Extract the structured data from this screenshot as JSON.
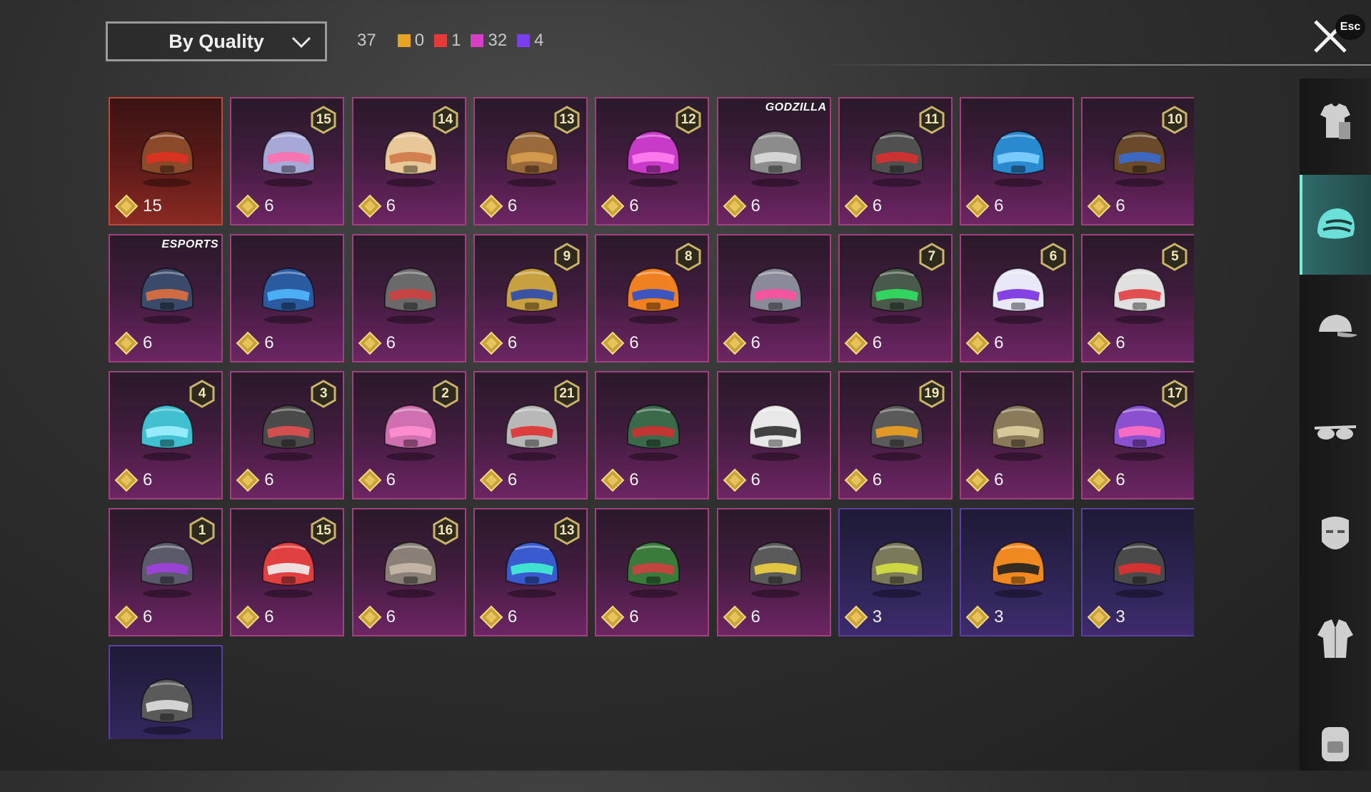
{
  "sort": {
    "label": "By Quality"
  },
  "counts": {
    "total": "37",
    "qualities": [
      {
        "color": "#e8a322",
        "value": "0"
      },
      {
        "color": "#e53a35",
        "value": "1"
      },
      {
        "color": "#d63fc4",
        "value": "32"
      },
      {
        "color": "#7a3df0",
        "value": "4"
      }
    ]
  },
  "close": {
    "esc_label": "Esc"
  },
  "items": [
    {
      "quality": "legendary",
      "price": "15",
      "badge": "",
      "tag": "",
      "color": "#8a4a2a",
      "accent": "#e03020"
    },
    {
      "quality": "mythic",
      "price": "6",
      "badge": "15",
      "tag": "",
      "color": "#a8a8d8",
      "accent": "#ff6fae"
    },
    {
      "quality": "mythic",
      "price": "6",
      "badge": "14",
      "tag": "",
      "color": "#e8c898",
      "accent": "#d07848"
    },
    {
      "quality": "mythic",
      "price": "6",
      "badge": "13",
      "tag": "",
      "color": "#9a6a3a",
      "accent": "#d9a050"
    },
    {
      "quality": "mythic",
      "price": "6",
      "badge": "12",
      "tag": "",
      "color": "#c83ac8",
      "accent": "#ff7ff0"
    },
    {
      "quality": "mythic",
      "price": "6",
      "badge": "",
      "tag": "GODZILLA",
      "color": "#8c8c8c",
      "accent": "#dcdcdc"
    },
    {
      "quality": "mythic",
      "price": "6",
      "badge": "11",
      "tag": "",
      "color": "#505050",
      "accent": "#d83030"
    },
    {
      "quality": "mythic",
      "price": "6",
      "badge": "",
      "tag": "",
      "color": "#2a8ad0",
      "accent": "#7fd0ff"
    },
    {
      "quality": "mythic",
      "price": "6",
      "badge": "10",
      "tag": "",
      "color": "#6a4a2a",
      "accent": "#3a6ad0"
    },
    {
      "quality": "mythic",
      "price": "6",
      "badge": "",
      "tag": "ESPORTS",
      "color": "#3a4a6a",
      "accent": "#e07040"
    },
    {
      "quality": "mythic",
      "price": "6",
      "badge": "",
      "tag": "",
      "color": "#2a5aa0",
      "accent": "#50b8ff"
    },
    {
      "quality": "mythic",
      "price": "6",
      "badge": "",
      "tag": "",
      "color": "#6a6a6a",
      "accent": "#d04040"
    },
    {
      "quality": "mythic",
      "price": "6",
      "badge": "9",
      "tag": "",
      "color": "#c8a040",
      "accent": "#2a4ab0"
    },
    {
      "quality": "mythic",
      "price": "6",
      "badge": "8",
      "tag": "",
      "color": "#f08020",
      "accent": "#2a50d0"
    },
    {
      "quality": "mythic",
      "price": "6",
      "badge": "",
      "tag": "",
      "color": "#8a8a9a",
      "accent": "#ff4fa0"
    },
    {
      "quality": "mythic",
      "price": "6",
      "badge": "7",
      "tag": "",
      "color": "#4a5a4a",
      "accent": "#30e060"
    },
    {
      "quality": "mythic",
      "price": "6",
      "badge": "6",
      "tag": "",
      "color": "#e8e8f8",
      "accent": "#7a30e0"
    },
    {
      "quality": "mythic",
      "price": "6",
      "badge": "5",
      "tag": "",
      "color": "#e0e0e0",
      "accent": "#e04040"
    },
    {
      "quality": "mythic",
      "price": "6",
      "badge": "4",
      "tag": "",
      "color": "#40c0d0",
      "accent": "#a0f0ff"
    },
    {
      "quality": "mythic",
      "price": "6",
      "badge": "3",
      "tag": "",
      "color": "#4a4a4a",
      "accent": "#e05050"
    },
    {
      "quality": "mythic",
      "price": "6",
      "badge": "2",
      "tag": "",
      "color": "#d070b0",
      "accent": "#ff90d0"
    },
    {
      "quality": "mythic",
      "price": "6",
      "badge": "21",
      "tag": "",
      "color": "#b8b8b8",
      "accent": "#e03030"
    },
    {
      "quality": "mythic",
      "price": "6",
      "badge": "",
      "tag": "",
      "color": "#3a6a4a",
      "accent": "#d03030"
    },
    {
      "quality": "mythic",
      "price": "6",
      "badge": "",
      "tag": "",
      "color": "#e8e8e8",
      "accent": "#303030"
    },
    {
      "quality": "mythic",
      "price": "6",
      "badge": "19",
      "tag": "",
      "color": "#5a5a5a",
      "accent": "#f0a020"
    },
    {
      "quality": "mythic",
      "price": "6",
      "badge": "",
      "tag": "",
      "color": "#8a7a5a",
      "accent": "#e0d0a0"
    },
    {
      "quality": "mythic",
      "price": "6",
      "badge": "17",
      "tag": "",
      "color": "#8a50d0",
      "accent": "#ff70c0"
    },
    {
      "quality": "mythic",
      "price": "6",
      "badge": "1",
      "tag": "",
      "color": "#5a5a6a",
      "accent": "#a040e0"
    },
    {
      "quality": "mythic",
      "price": "6",
      "badge": "15",
      "tag": "",
      "color": "#e04040",
      "accent": "#f0f0f0"
    },
    {
      "quality": "mythic",
      "price": "6",
      "badge": "16",
      "tag": "",
      "color": "#8a8078",
      "accent": "#c8b8a8"
    },
    {
      "quality": "mythic",
      "price": "6",
      "badge": "13",
      "tag": "",
      "color": "#3a5ad0",
      "accent": "#40f0d0"
    },
    {
      "quality": "mythic",
      "price": "6",
      "badge": "",
      "tag": "",
      "color": "#3a7a3a",
      "accent": "#d04040"
    },
    {
      "quality": "mythic",
      "price": "6",
      "badge": "",
      "tag": "",
      "color": "#5a5a5a",
      "accent": "#f0d040"
    },
    {
      "quality": "epic",
      "price": "3",
      "badge": "",
      "tag": "",
      "color": "#7a7a5a",
      "accent": "#d8e040"
    },
    {
      "quality": "epic",
      "price": "3",
      "badge": "",
      "tag": "",
      "color": "#f08a20",
      "accent": "#202020"
    },
    {
      "quality": "epic",
      "price": "3",
      "badge": "",
      "tag": "",
      "color": "#4a4a4a",
      "accent": "#e03030"
    },
    {
      "quality": "epic",
      "price": "",
      "badge": "",
      "tag": "",
      "color": "#5a5a5a",
      "accent": "#e0e0e0"
    }
  ],
  "sidebar": [
    {
      "name": "outfit-icon",
      "active": false
    },
    {
      "name": "helmet-icon",
      "active": true
    },
    {
      "name": "cap-icon",
      "active": false
    },
    {
      "name": "glasses-icon",
      "active": false
    },
    {
      "name": "mask-icon",
      "active": false
    },
    {
      "name": "jacket-icon",
      "active": false
    },
    {
      "name": "backpack-icon",
      "active": false
    }
  ]
}
